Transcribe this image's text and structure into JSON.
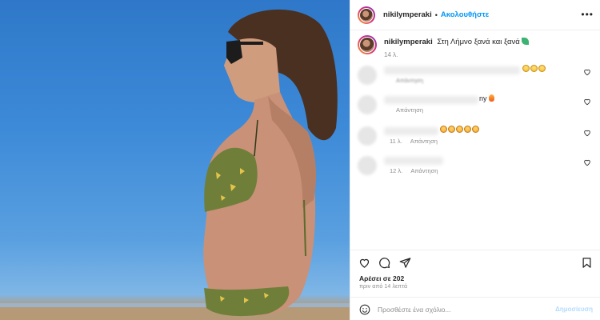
{
  "post": {
    "username": "nikilymperaki",
    "separator": "•",
    "follow_label": "Ακολουθήστε",
    "more_icon": "more-horizontal-icon",
    "caption_text": "Στη Λήμνο ξανά και ξανά",
    "caption_time": "14 λ."
  },
  "comments": [
    {
      "tail_text": "",
      "time": "",
      "reply_label": "Απάντηση"
    },
    {
      "tail_text": "ny",
      "time": "",
      "reply_label": "Απάντηση"
    },
    {
      "tail_text": "",
      "time": "11 λ.",
      "reply_label": "Απάντηση"
    },
    {
      "tail_text": "",
      "time": "12 λ.",
      "reply_label": "Απάντηση"
    }
  ],
  "footer": {
    "likes_text": "Αρέσει σε 202",
    "time_ago": "πριν από 14 λεπτά",
    "comment_placeholder": "Προσθέστε ένα σχόλιο...",
    "post_label": "Δημοσίευση"
  },
  "colors": {
    "accent": "#0095f6",
    "disabled_accent": "#b3dbff",
    "muted": "#8e8e8e"
  }
}
